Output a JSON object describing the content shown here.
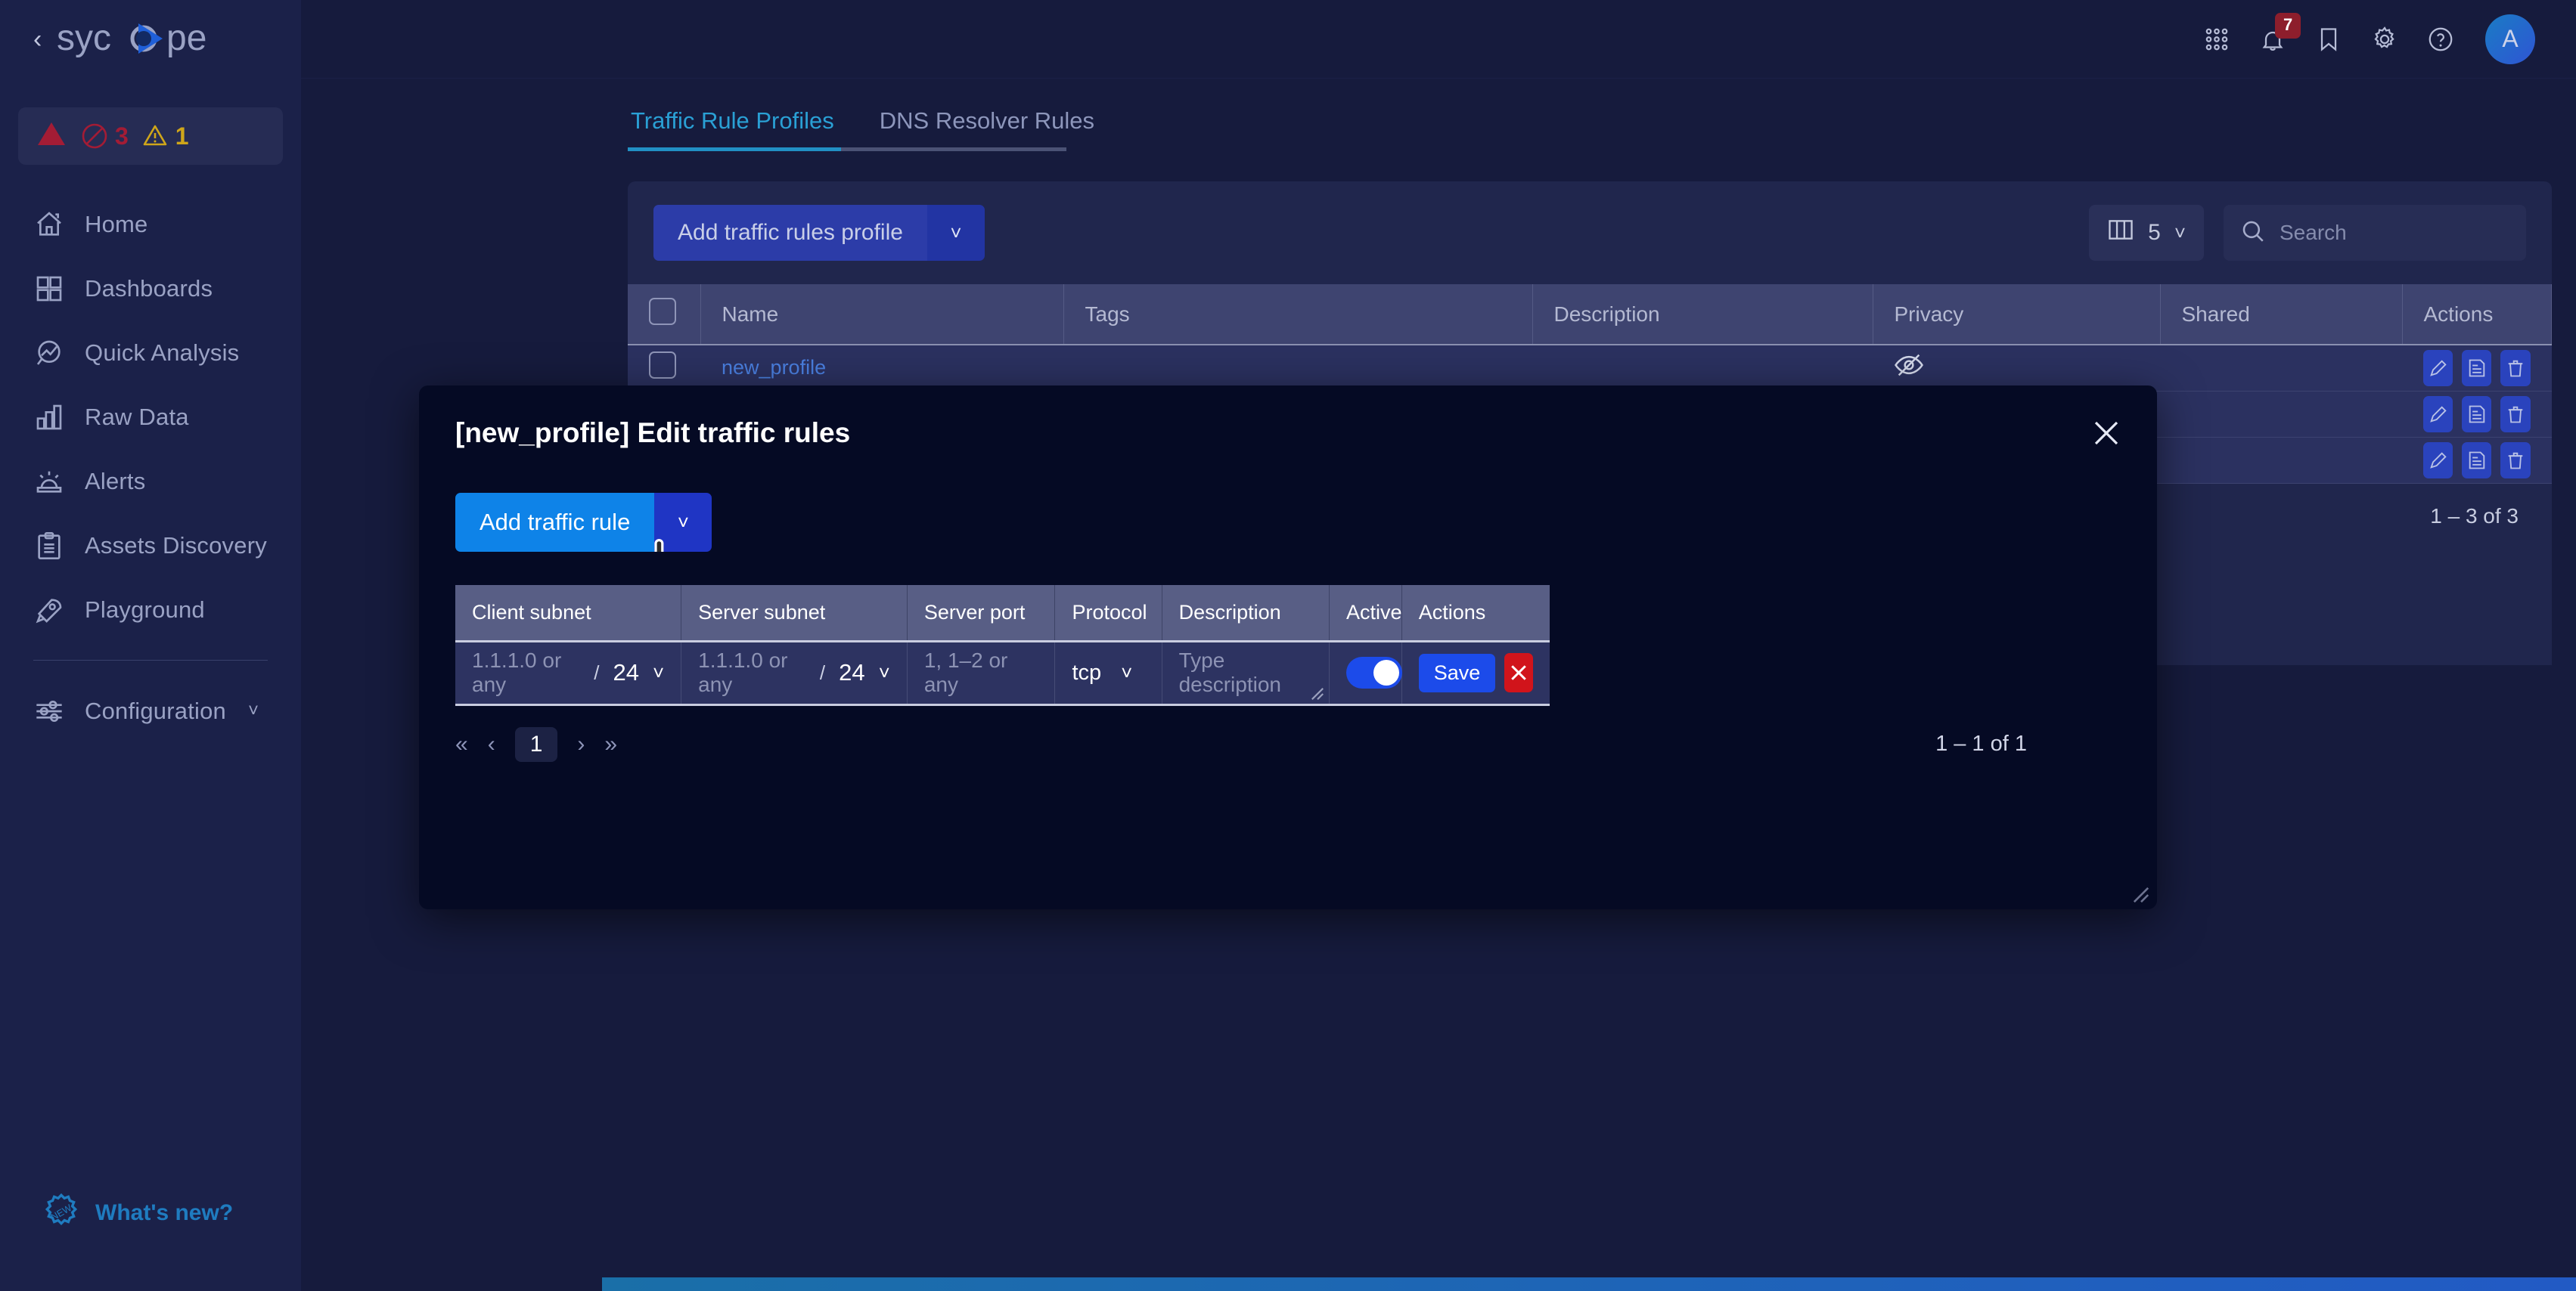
{
  "brand": {
    "name": "sycope",
    "collapse_icon": "chevron-left-icon"
  },
  "alerts": {
    "critical_icon": "triangle-alert-icon",
    "blocked_count": "3",
    "warning_count": "1"
  },
  "sidebar": {
    "items": [
      {
        "label": "Home",
        "icon": "home-icon"
      },
      {
        "label": "Dashboards",
        "icon": "grid-icon"
      },
      {
        "label": "Quick Analysis",
        "icon": "analysis-icon"
      },
      {
        "label": "Raw Data",
        "icon": "bar-chart-icon"
      },
      {
        "label": "Alerts",
        "icon": "siren-icon"
      },
      {
        "label": "Assets Discovery",
        "icon": "clipboard-icon"
      },
      {
        "label": "Playground",
        "icon": "rocket-icon"
      }
    ],
    "config": {
      "label": "Configuration",
      "icon": "sliders-icon",
      "chevron": "chevron-down-icon"
    },
    "whats_new": {
      "label": "What's new?",
      "icon": "new-badge-icon"
    }
  },
  "topbar": {
    "apps_icon": "apps-grid-icon",
    "notifications_icon": "bell-icon",
    "notifications_count": "7",
    "bookmark_icon": "bookmark-icon",
    "settings_icon": "gear-icon",
    "help_icon": "help-circle-icon",
    "avatar_initial": "A"
  },
  "tabs": [
    {
      "label": "Traffic Rule Profiles",
      "active": true
    },
    {
      "label": "DNS Resolver Rules",
      "active": false
    }
  ],
  "toolbar": {
    "add_profile_label": "Add traffic rules profile",
    "add_profile_chevron": "chevron-down-icon",
    "columns_count": "5",
    "columns_icon": "columns-icon",
    "columns_chevron": "chevron-down-icon",
    "search_placeholder": "Search",
    "search_value": "",
    "search_icon": "search-icon"
  },
  "profiles_table": {
    "columns": [
      "Name",
      "Tags",
      "Description",
      "Privacy",
      "Shared",
      "Actions"
    ],
    "rows": [
      {
        "name": "new_profile",
        "tags": "",
        "description": "",
        "privacy": "private-eye-icon",
        "shared": "",
        "actions": [
          "edit-icon",
          "rules-icon",
          "delete-icon"
        ]
      },
      {
        "name": "",
        "tags": "",
        "description": "",
        "privacy": "",
        "shared": "",
        "actions": [
          "edit-icon",
          "rules-icon",
          "delete-icon"
        ]
      },
      {
        "name": "",
        "tags": "",
        "description": "",
        "privacy": "",
        "shared": "",
        "actions": [
          "edit-icon",
          "rules-icon",
          "delete-icon"
        ]
      }
    ],
    "count_label": "1 – 3 of 3"
  },
  "modal": {
    "title": "[new_profile] Edit traffic rules",
    "close_icon": "close-icon",
    "add_rule_label": "Add traffic rule",
    "add_rule_chevron": "chevron-down-icon",
    "cursor": "hand-pointer-cursor",
    "rules_table": {
      "columns": [
        "Client subnet",
        "Server subnet",
        "Server port",
        "Protocol",
        "Description",
        "Active",
        "Actions"
      ],
      "row": {
        "client_subnet_placeholder": "1.1.1.0 or any",
        "client_subnet_value": "",
        "client_mask": "24",
        "server_subnet_placeholder": "1.1.1.0 or any",
        "server_subnet_value": "",
        "server_mask": "24",
        "server_port_placeholder": "1, 1–2 or any",
        "server_port_value": "",
        "protocol": "tcp",
        "description_placeholder": "Type description",
        "description_value": "",
        "active": true,
        "save_label": "Save",
        "cancel_icon": "cancel-x-icon"
      }
    },
    "pager": {
      "first_icon": "double-chevron-left-icon",
      "prev_icon": "chevron-left-icon",
      "current_page": "1",
      "next_icon": "chevron-right-icon",
      "last_icon": "double-chevron-right-icon"
    },
    "count_label": "1 – 1 of 1"
  },
  "colors": {
    "accent_blue": "#0e83e8",
    "primary_button": "#2c3ca8",
    "tab_active": "#2aa0d5",
    "danger": "#d1141b",
    "badge_red": "#8d1e2c"
  }
}
